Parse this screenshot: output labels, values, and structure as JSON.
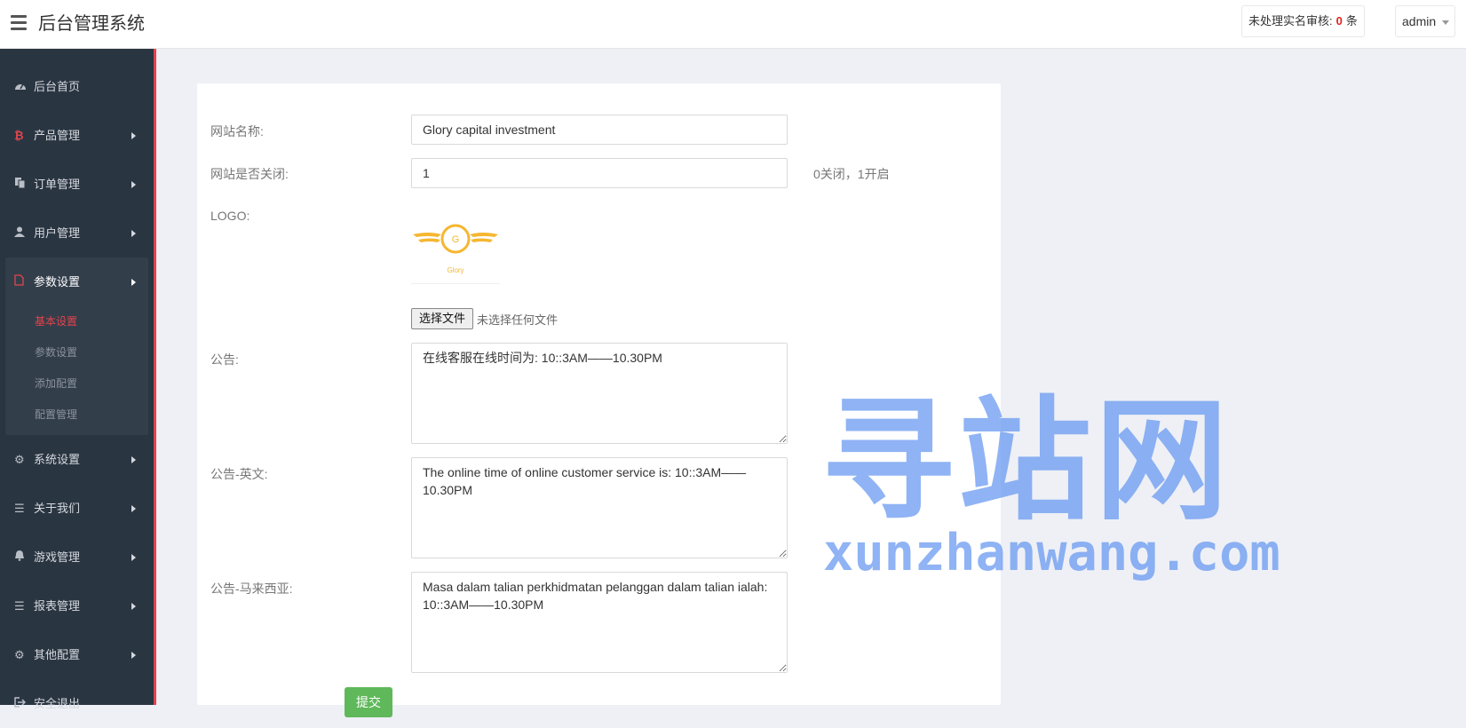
{
  "header": {
    "title": "后台管理系统",
    "pending_label": "未处理实名审核:",
    "pending_count": "0",
    "pending_unit": "条",
    "user": "admin"
  },
  "sidebar": {
    "items": [
      {
        "label": "后台首页",
        "icon": "dashboard-icon"
      },
      {
        "label": "产品管理",
        "icon": "bitcoin-icon"
      },
      {
        "label": "订单管理",
        "icon": "copy-icon"
      },
      {
        "label": "用户管理",
        "icon": "user-icon"
      },
      {
        "label": "参数设置",
        "icon": "file-icon"
      },
      {
        "label": "系统设置",
        "icon": "cogs-icon"
      },
      {
        "label": "关于我们",
        "icon": "list-icon"
      },
      {
        "label": "游戏管理",
        "icon": "bell-icon"
      },
      {
        "label": "报表管理",
        "icon": "list-icon"
      },
      {
        "label": "其他配置",
        "icon": "gear-icon"
      },
      {
        "label": "安全退出",
        "icon": "sign-out-icon"
      }
    ],
    "sub_items": [
      "基本设置",
      "参数设置",
      "添加配置",
      "配置管理"
    ]
  },
  "form": {
    "site_name_label": "网站名称:",
    "site_name_value": "Glory capital investment",
    "site_closed_label": "网站是否关闭:",
    "site_closed_value": "1",
    "site_closed_hint": "0关闭，1开启",
    "logo_label": "LOGO:",
    "logo_text": "Glory",
    "logo_letter": "G",
    "file_button": "选择文件",
    "file_status": "未选择任何文件",
    "notice_label": "公告:",
    "notice_value": "在线客服在线时间为: 10::3AM——10.30PM",
    "notice_en_label": "公告-英文:",
    "notice_en_value": "The online time of online customer service is: 10::3AM——10.30PM",
    "notice_my_label": "公告-马来西亚:",
    "notice_my_value": "Masa dalam talian perkhidmatan pelanggan dalam talian ialah: 10::3AM——10.30PM",
    "submit_label": "提交"
  },
  "watermark": {
    "cn": "寻站网",
    "en": "xunzhanwang.com"
  },
  "colors": {
    "accent": "#e5434b",
    "sidebar_bg": "#2a3542",
    "submit": "#5fb85a",
    "logo_gold": "#f5b731",
    "watermark": "#6496f0"
  }
}
